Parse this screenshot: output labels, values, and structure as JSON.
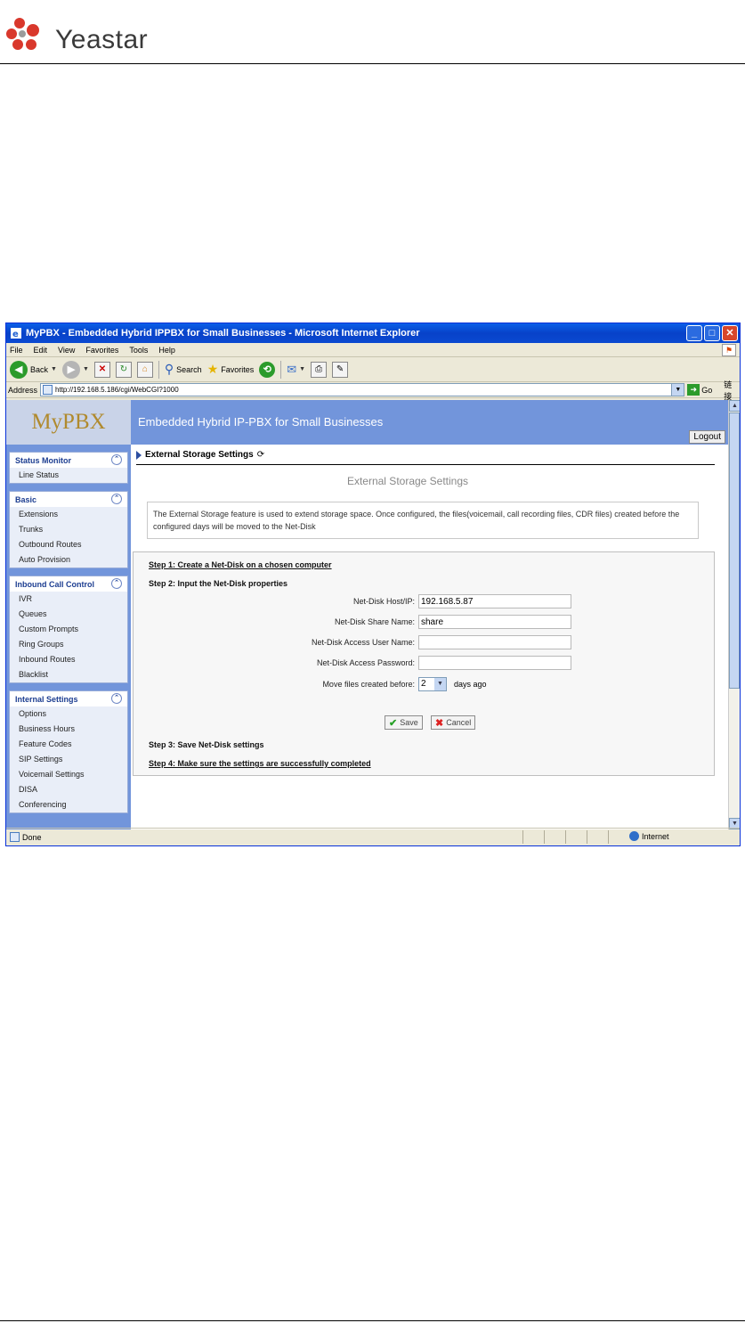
{
  "doc": {
    "brand": "Yeastar"
  },
  "browser": {
    "title": "MyPBX - Embedded Hybrid IPPBX for Small Businesses - Microsoft Internet Explorer",
    "menu": [
      "File",
      "Edit",
      "View",
      "Favorites",
      "Tools",
      "Help"
    ],
    "toolbar": {
      "back": "Back",
      "search": "Search",
      "favorites": "Favorites"
    },
    "address_label": "Address",
    "url": "http://192.168.5.186/cgi/WebCGI?1000",
    "go": "Go",
    "links": "链接",
    "status": "Done",
    "zone": "Internet"
  },
  "app": {
    "logo": "MyPBX",
    "title": "Embedded Hybrid IP-PBX for Small Businesses",
    "logout": "Logout",
    "sidebar": [
      {
        "header": "Status Monitor",
        "items": [
          "Line Status"
        ]
      },
      {
        "header": "Basic",
        "items": [
          "Extensions",
          "Trunks",
          "Outbound Routes",
          "Auto Provision"
        ]
      },
      {
        "header": "Inbound Call Control",
        "items": [
          "IVR",
          "Queues",
          "Custom Prompts",
          "Ring Groups",
          "Inbound Routes",
          "Blacklist"
        ]
      },
      {
        "header": "Internal Settings",
        "items": [
          "Options",
          "Business Hours",
          "Feature Codes",
          "SIP Settings",
          "Voicemail Settings",
          "DISA",
          "Conferencing"
        ]
      }
    ],
    "breadcrumb": "External Storage Settings",
    "section_title": "External Storage Settings",
    "description": "The External Storage feature is used to extend storage space. Once configured, the files(voicemail, call recording files, CDR files) created before the configured days will be moved to the Net-Disk",
    "step1": "Step 1: Create a Net-Disk on a chosen computer",
    "step2": "Step 2: Input the Net-Disk properties",
    "fields": {
      "host_label": "Net-Disk Host/IP:",
      "host_value": "192.168.5.87",
      "share_label": "Net-Disk Share Name:",
      "share_value": "share",
      "user_label": "Net-Disk Access User Name:",
      "user_value": "",
      "pass_label": "Net-Disk Access Password:",
      "pass_value": "",
      "move_label": "Move files created before:",
      "move_value": "2",
      "move_suffix": "days ago"
    },
    "save": "Save",
    "cancel": "Cancel",
    "step3": "Step 3: Save Net-Disk settings",
    "step4": "Step 4: Make sure the settings are successfully completed"
  }
}
